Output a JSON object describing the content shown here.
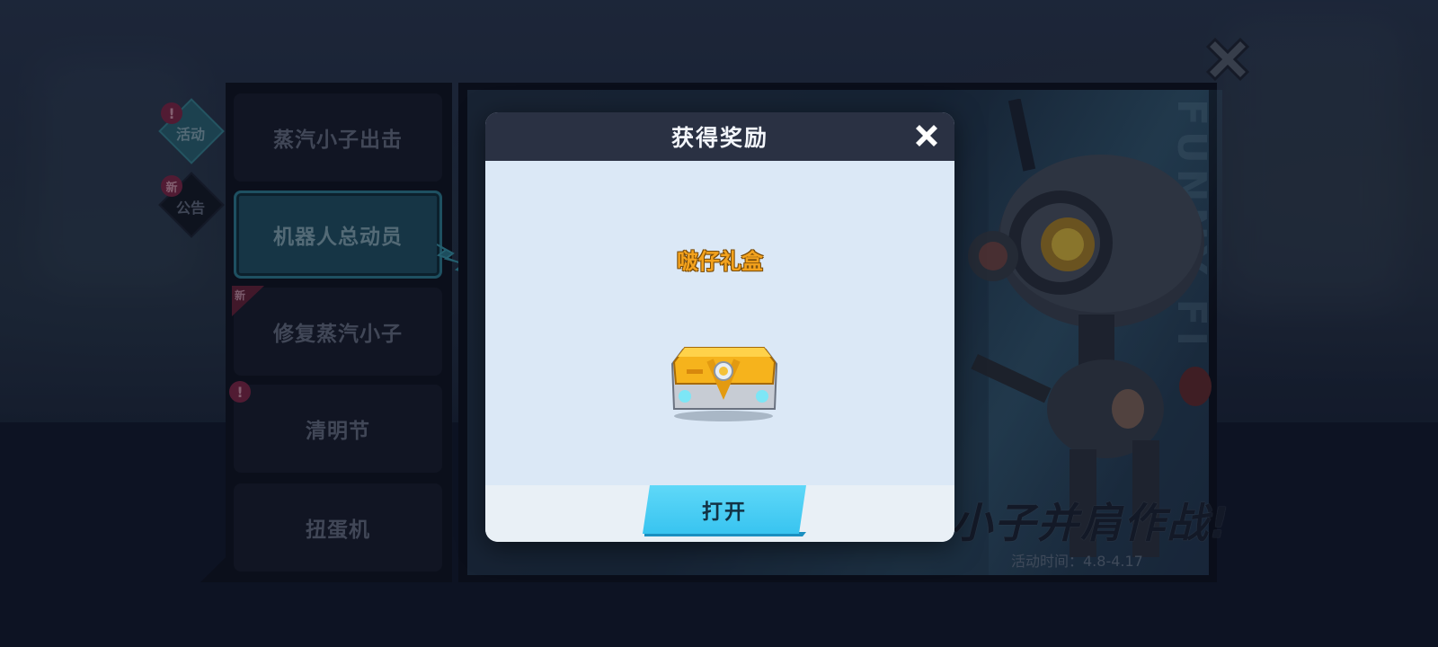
{
  "sidebar_tabs": [
    {
      "label": "活动",
      "badge": "!"
    },
    {
      "label": "公告",
      "badge": "新"
    }
  ],
  "menu": {
    "items": [
      {
        "label": "蒸汽小子出击"
      },
      {
        "label": "机器人总动员",
        "active": true
      },
      {
        "label": "修复蒸汽小子",
        "badge": "新"
      },
      {
        "label": "清明节",
        "badge": "!"
      },
      {
        "label": "扭蛋机"
      }
    ]
  },
  "banner": {
    "vertical_text": "FUNNY FI",
    "slogan": "小子并肩作战!",
    "time_label": "活动时间：4.8-4.17"
  },
  "modal": {
    "title": "获得奖励",
    "reward_name": "啵仔礼盒",
    "reward_icon": "treasure-chest-icon",
    "open_button": "打开"
  },
  "colors": {
    "accent": "#38c4f0",
    "reward_gold": "#f3a21d",
    "active_tab": "#1f5566",
    "badge": "#8a2646"
  }
}
